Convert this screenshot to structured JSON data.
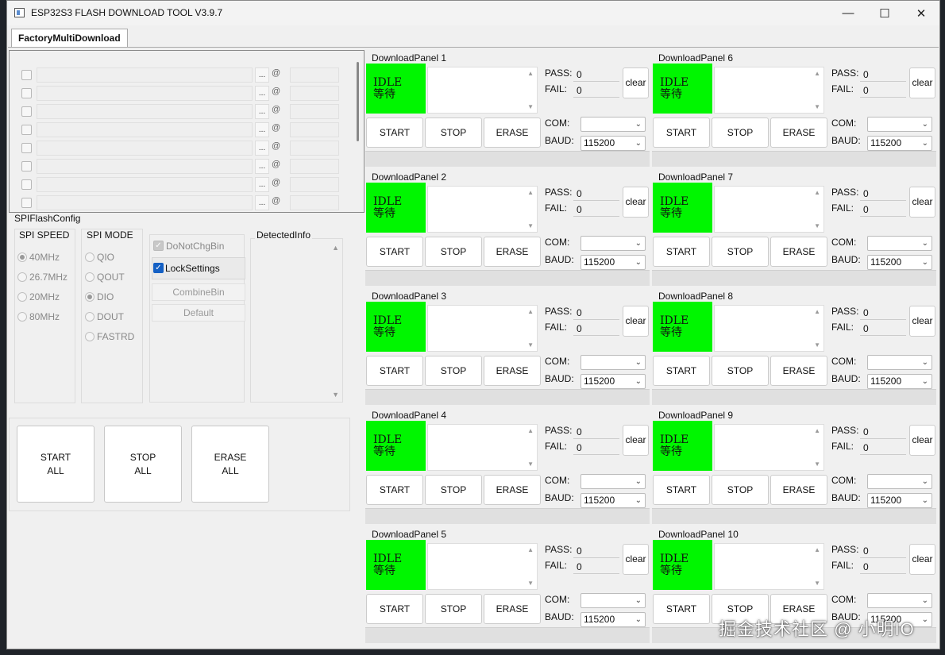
{
  "window": {
    "title": "ESP32S3 FLASH DOWNLOAD TOOL V3.9.7",
    "minimize": "—",
    "maximize": "☐",
    "close": "✕"
  },
  "tab": "FactoryMultiDownload",
  "file_rows": [
    {
      "dots": "...",
      "at": "@"
    },
    {
      "dots": "...",
      "at": "@"
    },
    {
      "dots": "...",
      "at": "@"
    },
    {
      "dots": "...",
      "at": "@"
    },
    {
      "dots": "...",
      "at": "@"
    },
    {
      "dots": "...",
      "at": "@"
    },
    {
      "dots": "...",
      "at": "@"
    },
    {
      "dots": "...",
      "at": "@"
    }
  ],
  "spi": {
    "title": "SPIFlashConfig",
    "speed_title": "SPI SPEED",
    "speeds": [
      "40MHz",
      "26.7MHz",
      "20MHz",
      "80MHz"
    ],
    "speed_selected": "40MHz",
    "mode_title": "SPI MODE",
    "modes": [
      "QIO",
      "QOUT",
      "DIO",
      "DOUT",
      "FASTRD"
    ],
    "mode_selected": "DIO",
    "do_not_chg_bin": "DoNotChgBin",
    "lock_settings": "LockSettings",
    "combine_bin": "CombineBin",
    "default": "Default",
    "detected_info": "DetectedInfo"
  },
  "all_buttons": {
    "start": [
      "START",
      "ALL"
    ],
    "stop": [
      "STOP",
      "ALL"
    ],
    "erase": [
      "ERASE",
      "ALL"
    ]
  },
  "panels": [
    {
      "title": "DownloadPanel 1",
      "status_en": "IDLE",
      "status_cn": "等待",
      "pass": "0",
      "fail": "0",
      "baud": "115200"
    },
    {
      "title": "DownloadPanel 2",
      "status_en": "IDLE",
      "status_cn": "等待",
      "pass": "0",
      "fail": "0",
      "baud": "115200"
    },
    {
      "title": "DownloadPanel 3",
      "status_en": "IDLE",
      "status_cn": "等待",
      "pass": "0",
      "fail": "0",
      "baud": "115200"
    },
    {
      "title": "DownloadPanel 4",
      "status_en": "IDLE",
      "status_cn": "等待",
      "pass": "0",
      "fail": "0",
      "baud": "115200"
    },
    {
      "title": "DownloadPanel 5",
      "status_en": "IDLE",
      "status_cn": "等待",
      "pass": "0",
      "fail": "0",
      "baud": "115200"
    },
    {
      "title": "DownloadPanel 6",
      "status_en": "IDLE",
      "status_cn": "等待",
      "pass": "0",
      "fail": "0",
      "baud": "115200"
    },
    {
      "title": "DownloadPanel 7",
      "status_en": "IDLE",
      "status_cn": "等待",
      "pass": "0",
      "fail": "0",
      "baud": "115200"
    },
    {
      "title": "DownloadPanel 8",
      "status_en": "IDLE",
      "status_cn": "等待",
      "pass": "0",
      "fail": "0",
      "baud": "115200"
    },
    {
      "title": "DownloadPanel 9",
      "status_en": "IDLE",
      "status_cn": "等待",
      "pass": "0",
      "fail": "0",
      "baud": "115200"
    },
    {
      "title": "DownloadPanel 10",
      "status_en": "IDLE",
      "status_cn": "等待",
      "pass": "0",
      "fail": "0",
      "baud": "115200"
    }
  ],
  "panel_labels": {
    "pass": "PASS:",
    "fail": "FAIL:",
    "clear": "clear",
    "start": "START",
    "stop": "STOP",
    "erase": "ERASE",
    "com": "COM:",
    "baud": "BAUD:"
  },
  "status_color": "#00f600",
  "watermark": "掘金技术社区 @ 小明IO"
}
